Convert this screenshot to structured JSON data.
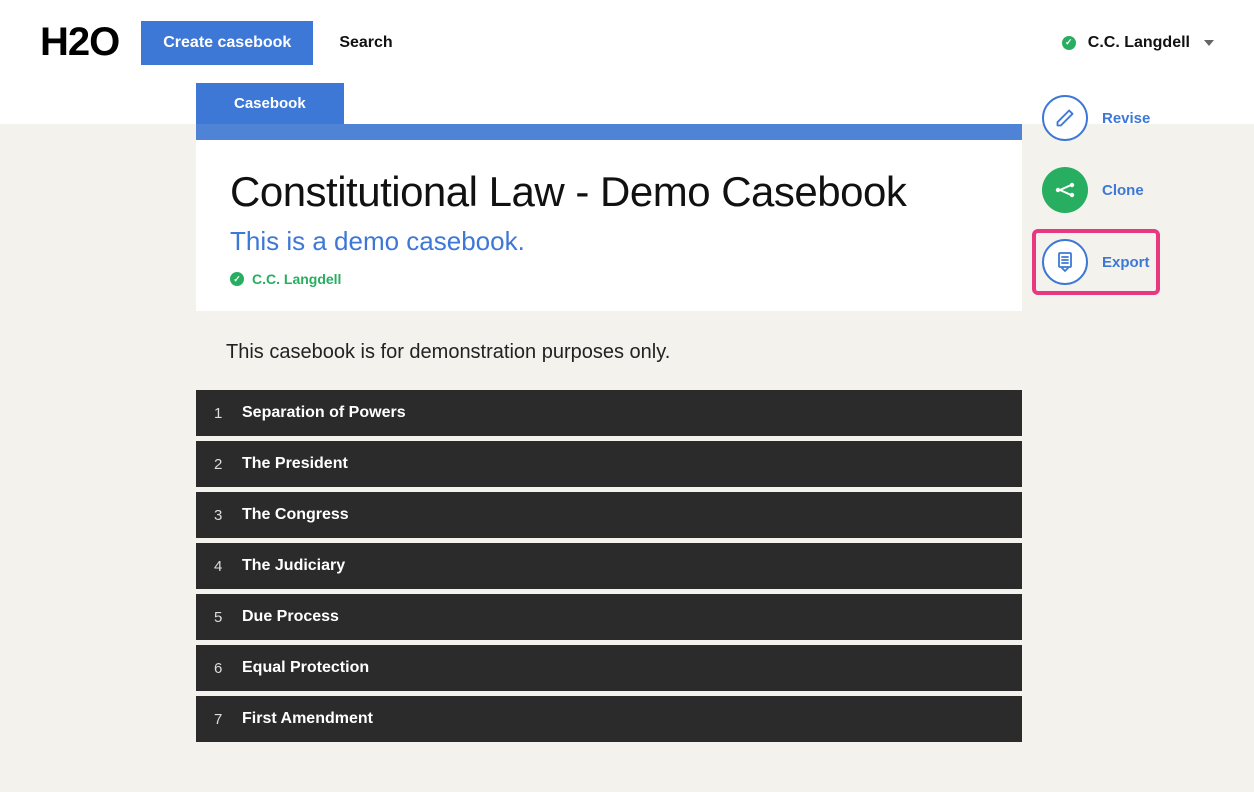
{
  "header": {
    "logo": "H2O",
    "create_label": "Create casebook",
    "search_label": "Search",
    "user_name": "C.C. Langdell"
  },
  "tab": {
    "label": "Casebook"
  },
  "casebook": {
    "title": "Constitutional Law - Demo Casebook",
    "subtitle": "This is a demo casebook.",
    "author": "C.C. Langdell",
    "description": "This casebook is for demonstration purposes only."
  },
  "chapters": [
    {
      "num": "1",
      "title": "Separation of Powers"
    },
    {
      "num": "2",
      "title": "The President"
    },
    {
      "num": "3",
      "title": "The Congress"
    },
    {
      "num": "4",
      "title": "The Judiciary"
    },
    {
      "num": "5",
      "title": "Due Process"
    },
    {
      "num": "6",
      "title": "Equal Protection"
    },
    {
      "num": "7",
      "title": "First Amendment"
    }
  ],
  "actions": {
    "revise": "Revise",
    "clone": "Clone",
    "export": "Export"
  }
}
